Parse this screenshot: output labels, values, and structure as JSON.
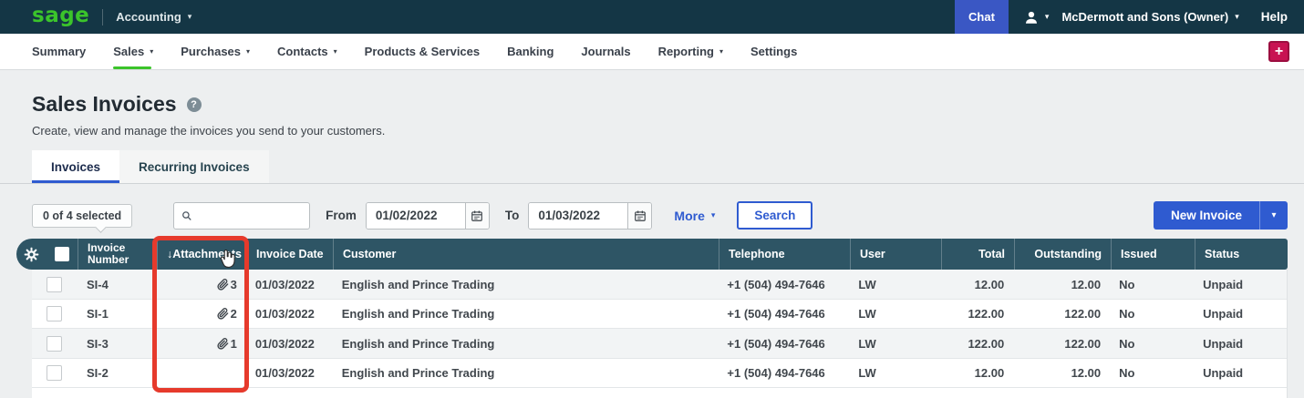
{
  "topbar": {
    "brand": "sage",
    "product": "Accounting",
    "chat_label": "Chat",
    "account_name": "McDermott and Sons (Owner)",
    "help_label": "Help"
  },
  "nav": {
    "items": [
      {
        "label": "Summary",
        "caret": false,
        "active": false
      },
      {
        "label": "Sales",
        "caret": true,
        "active": true
      },
      {
        "label": "Purchases",
        "caret": true,
        "active": false
      },
      {
        "label": "Contacts",
        "caret": true,
        "active": false
      },
      {
        "label": "Products & Services",
        "caret": false,
        "active": false
      },
      {
        "label": "Banking",
        "caret": false,
        "active": false
      },
      {
        "label": "Journals",
        "caret": false,
        "active": false
      },
      {
        "label": "Reporting",
        "caret": true,
        "active": false
      },
      {
        "label": "Settings",
        "caret": false,
        "active": false
      }
    ],
    "add_button_label": "+"
  },
  "page": {
    "title": "Sales Invoices",
    "help_glyph": "?",
    "subtitle": "Create, view and manage the invoices you send to your customers.",
    "tabs": [
      {
        "label": "Invoices",
        "active": true
      },
      {
        "label": "Recurring Invoices",
        "active": false
      }
    ]
  },
  "toolbar": {
    "selection_tooltip": "0 of 4 selected",
    "search_placeholder": "",
    "from_label": "From",
    "from_value": "01/02/2022",
    "to_label": "To",
    "to_value": "01/03/2022",
    "more_label": "More",
    "search_button_label": "Search",
    "new_invoice_label": "New Invoice"
  },
  "table": {
    "sort_arrow": "↓",
    "columns": {
      "invoice_number_line1": "Invoice",
      "invoice_number_line2": "Number",
      "attachments": "Attachments",
      "invoice_date": "Invoice Date",
      "customer": "Customer",
      "telephone": "Telephone",
      "user": "User",
      "total": "Total",
      "outstanding": "Outstanding",
      "issued": "Issued",
      "status": "Status"
    },
    "rows": [
      {
        "invoice_number": "SI-4",
        "attachments": "3",
        "invoice_date": "01/03/2022",
        "customer": "English and Prince Trading",
        "telephone": "+1 (504) 494-7646",
        "user": "LW",
        "total": "12.00",
        "outstanding": "12.00",
        "issued": "No",
        "status": "Unpaid"
      },
      {
        "invoice_number": "SI-1",
        "attachments": "2",
        "invoice_date": "01/03/2022",
        "customer": "English and Prince Trading",
        "telephone": "+1 (504) 494-7646",
        "user": "LW",
        "total": "122.00",
        "outstanding": "122.00",
        "issued": "No",
        "status": "Unpaid"
      },
      {
        "invoice_number": "SI-3",
        "attachments": "1",
        "invoice_date": "01/03/2022",
        "customer": "English and Prince Trading",
        "telephone": "+1 (504) 494-7646",
        "user": "LW",
        "total": "122.00",
        "outstanding": "122.00",
        "issued": "No",
        "status": "Unpaid"
      },
      {
        "invoice_number": "SI-2",
        "attachments": "",
        "invoice_date": "01/03/2022",
        "customer": "English and Prince Trading",
        "telephone": "+1 (504) 494-7646",
        "user": "LW",
        "total": "12.00",
        "outstanding": "12.00",
        "issued": "No",
        "status": "Unpaid"
      }
    ]
  },
  "colors": {
    "navbar_bg": "#143645",
    "brand_green": "#3bc42b",
    "chat_blue": "#3a57c4",
    "accent_blue": "#2f5bd0",
    "header_teal": "#2e5565",
    "highlight_red": "#e63a2c",
    "add_pink": "#c81252"
  }
}
